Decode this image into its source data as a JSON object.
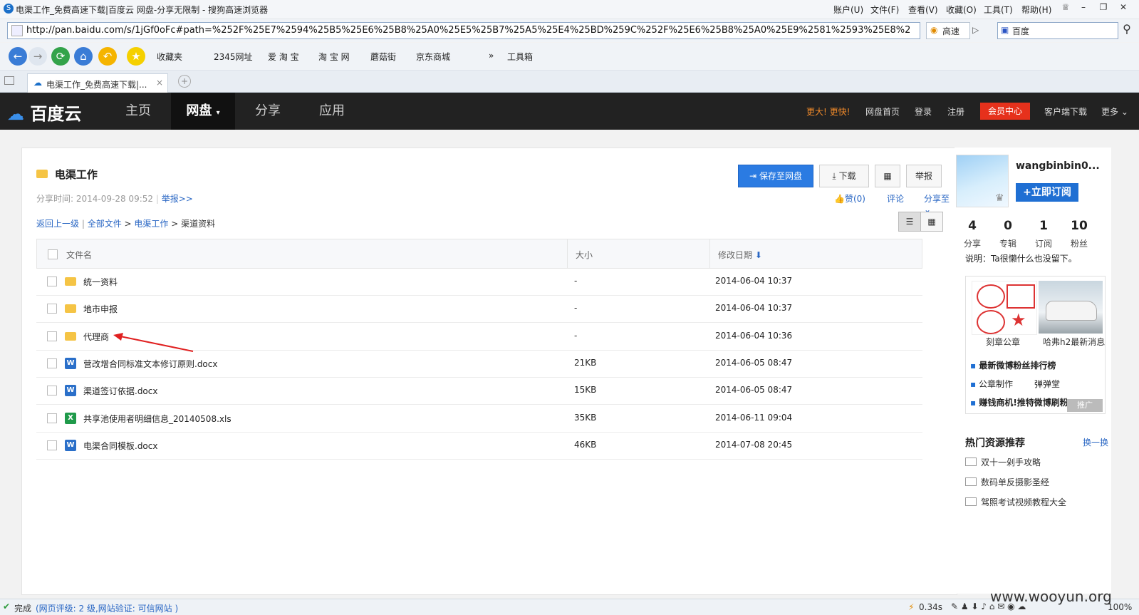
{
  "browser": {
    "title": "电渠工作_免费高速下载|百度云 网盘-分享无限制 - 搜狗高速浏览器",
    "menu": [
      "账户(U)",
      "文件(F)",
      "查看(V)",
      "收藏(O)",
      "工具(T)",
      "帮助(H)"
    ],
    "url": "http://pan.baidu.com/s/1jGf0oFc#path=%252F%25E7%2594%25B5%25E6%25B8%25A0%25E5%25B7%25A5%25E4%25BD%259C%252F%25E6%25B8%25A0%25E9%2581%2593%25E8%25",
    "speed_label": "高速",
    "search_placeholder": "百度",
    "favorites": [
      "收藏夹",
      "2345网址",
      "爱 淘 宝",
      "淘 宝 网",
      "蘑菇街",
      "京东商城"
    ],
    "toolbox_label": "工具箱",
    "tab_title": "电渠工作_免费高速下载|..."
  },
  "baidu": {
    "logo": "百度云",
    "nav": [
      "主页",
      "网盘",
      "分享",
      "应用"
    ],
    "right_links": {
      "promo": "更大! 更快!",
      "home": "网盘首页",
      "login": "登录",
      "register": "注册",
      "vip": "会员中心",
      "client": "客户端下载",
      "more": "更多"
    }
  },
  "share": {
    "folder_title": "电渠工作",
    "share_time_label": "分享时间:",
    "share_time": "2014-09-28 09:52",
    "report_link": "举报>>",
    "save_btn": "保存至网盘",
    "download_btn": "下载",
    "report_btn": "举报",
    "like": "赞(0)",
    "comment": "评论",
    "share_to": "分享至",
    "breadcrumb": {
      "back": "返回上一级",
      "all": "全部文件",
      "parent": "电渠工作",
      "current": "渠道资料"
    },
    "columns": {
      "name": "文件名",
      "size": "大小",
      "date": "修改日期"
    },
    "files": [
      {
        "type": "folder",
        "name": "统一资料",
        "size": "-",
        "date": "2014-06-04 10:37"
      },
      {
        "type": "folder",
        "name": "地市申报",
        "size": "-",
        "date": "2014-06-04 10:37"
      },
      {
        "type": "folder",
        "name": "代理商",
        "size": "-",
        "date": "2014-06-04 10:36"
      },
      {
        "type": "word",
        "name": "营改增合同标准文本修订原则.docx",
        "size": "21KB",
        "date": "2014-06-05 08:47"
      },
      {
        "type": "word",
        "name": "渠道签订依据.docx",
        "size": "15KB",
        "date": "2014-06-05 08:47"
      },
      {
        "type": "excel",
        "name": "共享池使用者明细信息_20140508.xls",
        "size": "35KB",
        "date": "2014-06-11 09:04"
      },
      {
        "type": "word",
        "name": "电渠合同模板.docx",
        "size": "46KB",
        "date": "2014-07-08 20:45"
      }
    ]
  },
  "user": {
    "name": "wangbinbin0...",
    "subscribe_btn": "+立即订阅",
    "stats": [
      {
        "num": "4",
        "label": "分享"
      },
      {
        "num": "0",
        "label": "专辑"
      },
      {
        "num": "1",
        "label": "订阅"
      },
      {
        "num": "10",
        "label": "粉丝"
      }
    ],
    "desc": "说明：Ta很懒什么也没留下。"
  },
  "ads": {
    "img1_caption": "刻章公章",
    "img2_caption": "哈弗h2最新消息",
    "links": [
      "最新微博粉丝排行榜",
      "公章制作",
      "弹弹堂",
      "赚钱商机!推特微博刷粉..."
    ],
    "promo_tag": "推广"
  },
  "hot": {
    "title": "热门资源推荐",
    "refresh": "换一换",
    "items": [
      "双十一剁手攻略",
      "数码单反摄影圣经",
      "驾照考试视频教程大全"
    ]
  },
  "status": {
    "left": "完成",
    "rating": "(网页评级: 2 级,网站验证: 可信网站 )",
    "time": "0.34s",
    "zoom": "100%",
    "watermark": "www.wooyun.org"
  }
}
